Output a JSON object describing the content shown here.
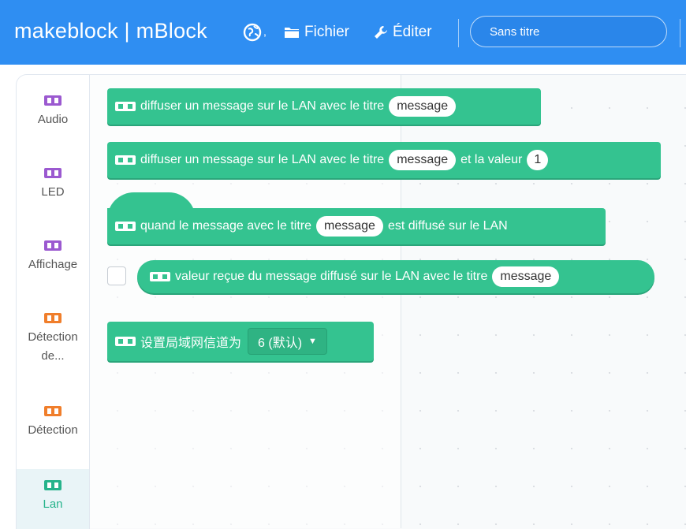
{
  "header": {
    "brand": "makeblock | mBlock",
    "menu_file": "Fichier",
    "menu_edit": "Éditer",
    "project_title": "Sans titre"
  },
  "sidebar": {
    "categories": [
      {
        "label": "Audio",
        "color": "#9b59d0"
      },
      {
        "label": "LED",
        "color": "#9b59d0"
      },
      {
        "label": "Affichage",
        "color": "#9b59d0"
      },
      {
        "label": "Détection de...",
        "label_line1": "Détection",
        "label_line2": "de...",
        "color": "#f07e2b"
      },
      {
        "label": "Détection",
        "color": "#f07e2b"
      },
      {
        "label": "Lan",
        "color": "#26b38b",
        "active": true
      }
    ]
  },
  "blocks": {
    "broadcast": {
      "text": "diffuser un message sur le LAN avec le titre",
      "arg": "message"
    },
    "broadcast_value": {
      "text": "diffuser un message sur le LAN avec le titre",
      "arg": "message",
      "text2": "et la valeur",
      "value": "1"
    },
    "when_received": {
      "text": "quand le message avec le titre",
      "arg": "message",
      "text2": "est diffusé sur le LAN"
    },
    "received_value": {
      "text": "valeur reçue du message diffusé sur le LAN avec le titre",
      "arg": "message"
    },
    "set_channel": {
      "text": "设置局域网信道为",
      "selected": "6 (默认)"
    }
  },
  "colors": {
    "topbar": "#2f8ef2",
    "block": "#34c390",
    "active_category": "#26b38b"
  }
}
